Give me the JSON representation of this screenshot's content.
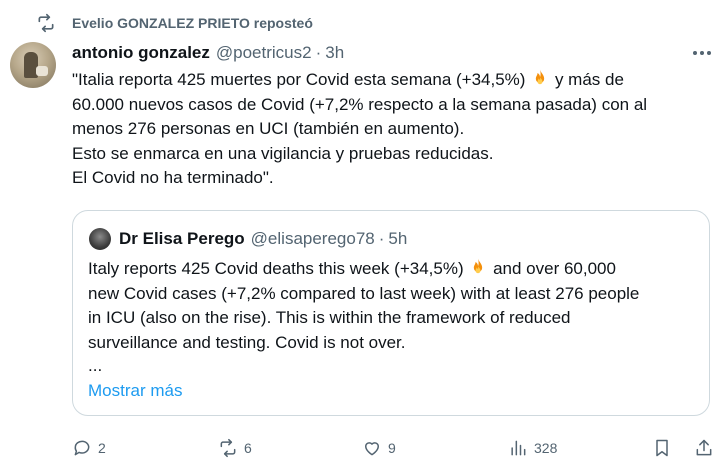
{
  "repost": {
    "label": "Evelio GONZALEZ PRIETO reposteó",
    "icon": "repost-icon"
  },
  "tweet": {
    "author_name": "antonio gonzalez",
    "author_handle": "@poetricus2",
    "separator": "·",
    "time": "3h",
    "text_lines": [
      "\"Italia reporta 425 muertes por Covid esta semana (+34,5%)",
      "y más de",
      "60.000 nuevos casos de Covid (+7,2% respecto a la semana pasada) con al",
      "menos 276 personas en UCI (también en aumento).",
      "Esto se enmarca en una vigilancia y pruebas reducidas.",
      "El Covid no ha terminado\"."
    ]
  },
  "quote": {
    "author_name": "Dr Elisa Perego",
    "author_handle": "@elisaperego78",
    "separator": "·",
    "time": "5h",
    "text_lines": [
      "Italy reports 425 Covid deaths this week (+34,5%)",
      "and over 60,000",
      "new Covid cases (+7,2% compared to last week) with at least 276 people",
      "in ICU (also on the rise). This is within the framework of reduced",
      "surveillance and testing. Covid is not over."
    ],
    "ellipsis": "...",
    "show_more": "Mostrar más"
  },
  "actions": {
    "replies": "2",
    "reposts": "6",
    "likes": "9",
    "views": "328"
  },
  "colors": {
    "text": "#0f1419",
    "muted": "#536471",
    "link": "#1d9bf0",
    "border": "#cfd9de"
  }
}
